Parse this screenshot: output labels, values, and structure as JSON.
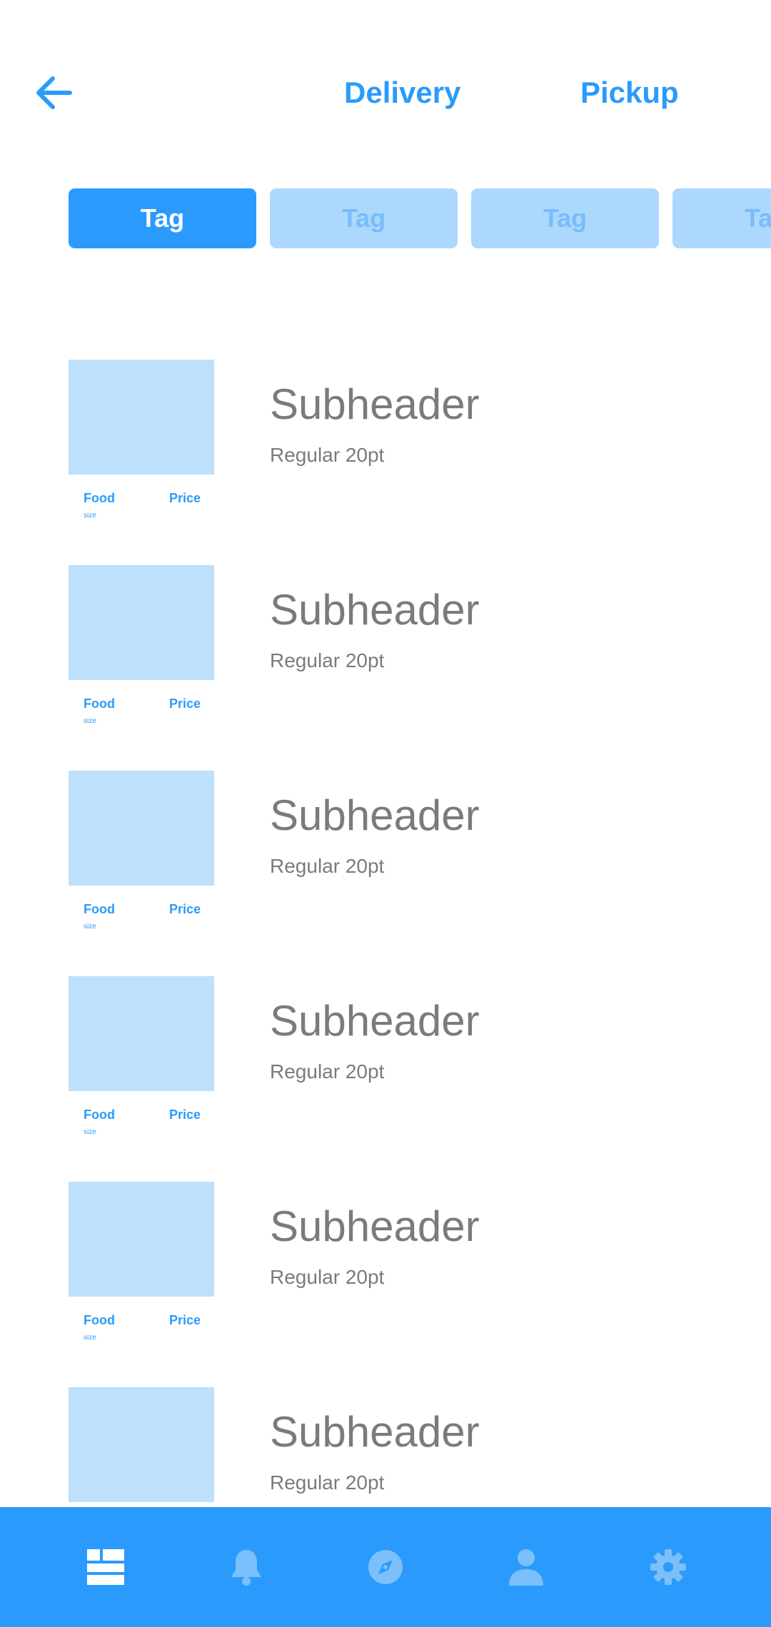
{
  "header": {
    "tabs": [
      {
        "label": "Delivery"
      },
      {
        "label": "Pickup"
      }
    ]
  },
  "tags": [
    "Tag",
    "Tag",
    "Tag",
    "Tag"
  ],
  "items": [
    {
      "food": "Food",
      "price": "Price",
      "size": "size",
      "title": "Subheader",
      "subtitle": "Regular 20pt"
    },
    {
      "food": "Food",
      "price": "Price",
      "size": "size",
      "title": "Subheader",
      "subtitle": "Regular 20pt"
    },
    {
      "food": "Food",
      "price": "Price",
      "size": "size",
      "title": "Subheader",
      "subtitle": "Regular 20pt"
    },
    {
      "food": "Food",
      "price": "Price",
      "size": "size",
      "title": "Subheader",
      "subtitle": "Regular 20pt"
    },
    {
      "food": "Food",
      "price": "Price",
      "size": "size",
      "title": "Subheader",
      "subtitle": "Regular 20pt"
    },
    {
      "food": "",
      "price": "",
      "size": "",
      "title": "Subheader",
      "subtitle": "Regular 20pt"
    }
  ],
  "bottom_nav": {
    "icons": [
      "dashboard-icon",
      "bell-icon",
      "compass-icon",
      "person-icon",
      "gear-icon"
    ],
    "active_color": "#ffffff",
    "inactive_color": "#7bc0fb"
  },
  "colors": {
    "accent": "#2a9bfc",
    "tag_inactive_bg": "#acd8fd",
    "thumb": "#bde0fd",
    "text_gray": "#7b7b7b"
  }
}
